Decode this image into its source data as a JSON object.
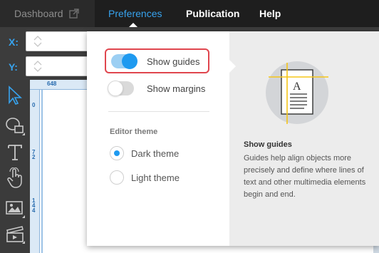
{
  "nav": {
    "dashboard": "Dashboard",
    "preferences": "Preferences",
    "publication": "Publication",
    "help": "Help",
    "dashboard_icon": "external-link-icon"
  },
  "coords": {
    "x_label": "X:",
    "y_label": "Y:"
  },
  "ruler": {
    "top_value": "648",
    "left_values": [
      "0",
      "72",
      "144"
    ]
  },
  "tools": [
    "select-arrow-icon",
    "shape-icon",
    "text-icon",
    "hand-pointer-icon",
    "image-icon",
    "video-icon"
  ],
  "preferences": {
    "show_guides": {
      "label": "Show guides",
      "enabled": true
    },
    "show_margins": {
      "label": "Show margins",
      "enabled": false
    },
    "editor_theme_label": "Editor theme",
    "themes": [
      {
        "label": "Dark theme",
        "selected": true
      },
      {
        "label": "Light theme",
        "selected": false
      }
    ]
  },
  "info": {
    "title": "Show guides",
    "body": "Guides help align objects more precisely and define where lines of text and other multimedia elements begin and end."
  },
  "colors": {
    "accent": "#1e9af0",
    "highlight": "#e0464e",
    "nav_bg": "#1e1e1e",
    "guide": "#f5c518"
  }
}
